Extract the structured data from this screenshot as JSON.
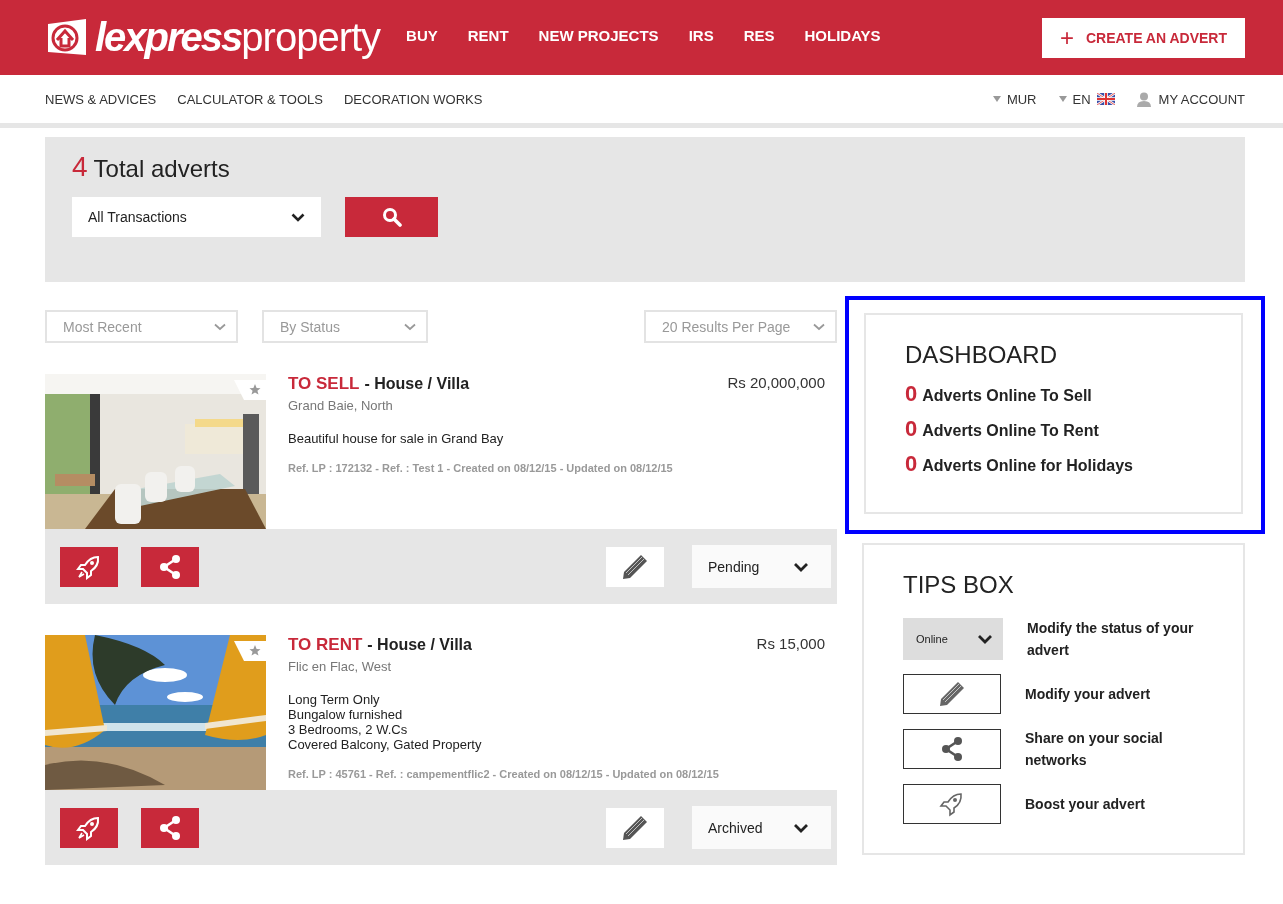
{
  "header": {
    "logo": {
      "bold": "lexpress",
      "light": "property"
    },
    "nav": [
      "BUY",
      "RENT",
      "NEW PROJECTS",
      "IRS",
      "RES",
      "HOLIDAYS"
    ],
    "create_button": {
      "icon": "+",
      "label": "CREATE AN ADVERT"
    }
  },
  "subnav": {
    "links": [
      "NEWS & ADVICES",
      "CALCULATOR & TOOLS",
      "DECORATION WORKS"
    ],
    "currency": "MUR",
    "language": "EN",
    "account": "MY ACCOUNT"
  },
  "summary": {
    "count": "4",
    "label": "Total adverts",
    "transaction_select": "All Transactions"
  },
  "filters": {
    "sort": "Most Recent",
    "status": "By Status",
    "per_page": "20 Results Per Page"
  },
  "adverts": [
    {
      "deal": "TO SELL",
      "type": "- House / Villa",
      "location": "Grand Baie, North",
      "price": "Rs 20,000,000",
      "description": [
        "Beautiful house for sale in Grand Bay"
      ],
      "ref": "Ref. LP : 172132 - Ref. : Test 1 - Created on 08/12/15 - Updated on 08/12/15",
      "status": "Pending"
    },
    {
      "deal": "TO RENT",
      "type": "- House / Villa",
      "location": "Flic en Flac, West",
      "price": "Rs 15,000",
      "description": [
        "Long Term Only",
        "Bungalow furnished",
        "3 Bedrooms, 2 W.Cs",
        "Covered Balcony, Gated Property"
      ],
      "ref": "Ref. LP : 45761 - Ref. : campementflic2 - Created on 08/12/15 - Updated on 08/12/15",
      "status": "Archived"
    }
  ],
  "dashboard": {
    "title": "DASHBOARD",
    "highlighted": true,
    "stats": [
      {
        "count": "0",
        "label": "Adverts Online To Sell"
      },
      {
        "count": "0",
        "label": "Adverts Online To Rent"
      },
      {
        "count": "0",
        "label": "Adverts Online for Holidays"
      }
    ]
  },
  "tips": {
    "title": "TIPS BOX",
    "items": [
      {
        "kind": "status",
        "control": "Online",
        "text": "Modify the status of your advert"
      },
      {
        "kind": "edit",
        "text": "Modify your advert"
      },
      {
        "kind": "share",
        "text": "Share on your social networks"
      },
      {
        "kind": "boost",
        "text": "Boost your advert"
      }
    ]
  }
}
